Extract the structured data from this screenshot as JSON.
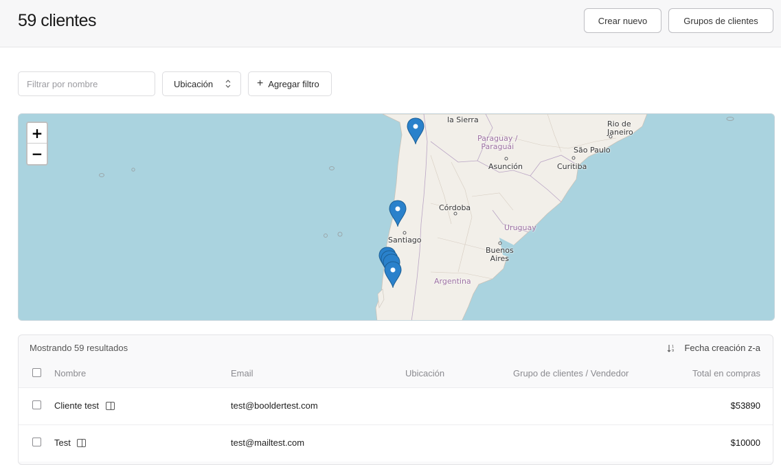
{
  "header": {
    "title": "59 clientes",
    "create_label": "Crear nuevo",
    "groups_label": "Grupos de clientes"
  },
  "filters": {
    "name_placeholder": "Filtrar por nombre",
    "location_label": "Ubicación",
    "add_filter_label": "Agregar filtro"
  },
  "map": {
    "zoom_in": "+",
    "zoom_out": "−",
    "labels": {
      "la_sierra": "la Sierra",
      "paraguay": "Paraguay /\nParaguái",
      "asuncion": "Asunción",
      "rio": "Rio de\nJaneiro",
      "sao_paulo": "São Paulo",
      "curitiba": "Curitiba",
      "cordoba": "Córdoba",
      "uruguay": "Uruguay",
      "santiago": "Santiago",
      "buenos_aires": "Buenos\nAires",
      "argentina": "Argentina"
    },
    "marker_color": "#2a81cb",
    "water_color": "#aad3df",
    "land_color": "#f2efe9"
  },
  "table": {
    "results_text": "Mostrando 59 resultados",
    "sort_label": "Fecha creación z-a",
    "columns": [
      "Nombre",
      "Email",
      "Ubicación",
      "Grupo de clientes / Vendedor",
      "Total en compras"
    ],
    "rows": [
      {
        "name": "Cliente test",
        "email": "test@booldertest.com",
        "location": "",
        "group": "",
        "total": "$53890"
      },
      {
        "name": "Test",
        "email": "test@mailtest.com",
        "location": "",
        "group": "",
        "total": "$10000"
      }
    ]
  }
}
